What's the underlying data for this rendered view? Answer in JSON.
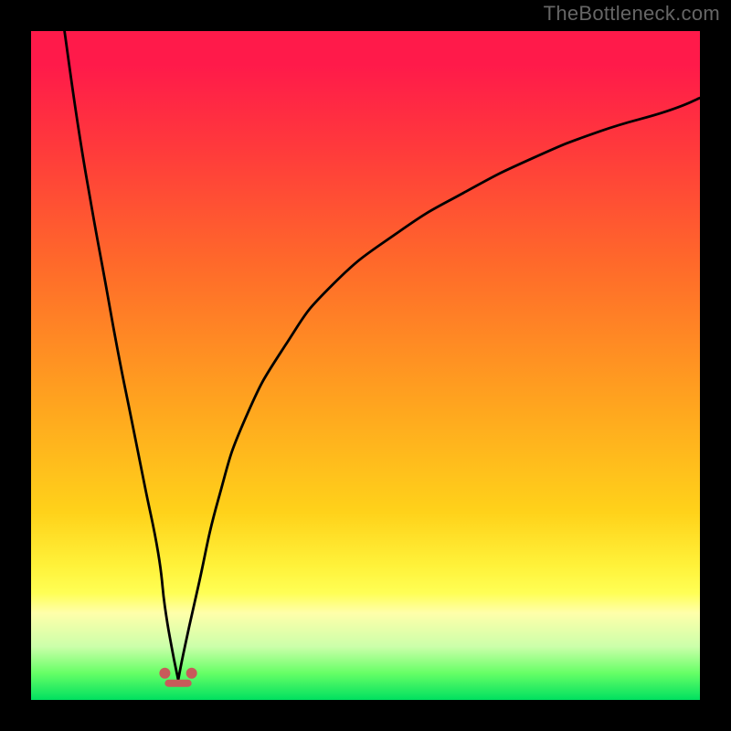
{
  "watermark": "TheBottleneck.com",
  "colors": {
    "background": "#000000",
    "curve": "#000000",
    "marker": "#c85a5a",
    "gradient_stops": [
      "#ff1a4a",
      "#ff3b3b",
      "#ff6a2a",
      "#ffa21f",
      "#ffd21a",
      "#fff23a",
      "#ffff55",
      "#ffffaa",
      "#ccffaa",
      "#66ff66",
      "#00e060"
    ]
  },
  "chart_data": {
    "type": "line",
    "title": "",
    "xlabel": "",
    "ylabel": "",
    "xlim": [
      0,
      100
    ],
    "ylim": [
      0,
      100
    ],
    "grid": false,
    "legend": false,
    "description": "V-shaped bottleneck curve overlaid on a red-to-green vertical gradient; minimum near x≈22 at y≈3",
    "series": [
      {
        "name": "left-branch",
        "x": [
          5,
          7,
          9,
          11,
          13,
          15,
          17,
          19,
          20,
          21,
          22
        ],
        "values": [
          100,
          86,
          74,
          63,
          52,
          42,
          32,
          22,
          14,
          8,
          3
        ]
      },
      {
        "name": "right-branch",
        "x": [
          22,
          23,
          25,
          28,
          32,
          38,
          45,
          55,
          65,
          75,
          85,
          95,
          100
        ],
        "values": [
          3,
          8,
          17,
          30,
          42,
          53,
          62,
          70,
          76,
          81,
          85,
          88,
          90
        ]
      }
    ],
    "markers": {
      "name": "floor-markers",
      "color": "#c85a5a",
      "points": [
        {
          "x": 20,
          "y": 4
        },
        {
          "x": 24,
          "y": 4
        }
      ],
      "bar": {
        "x_start": 20,
        "x_end": 24,
        "y": 2.5
      }
    }
  }
}
